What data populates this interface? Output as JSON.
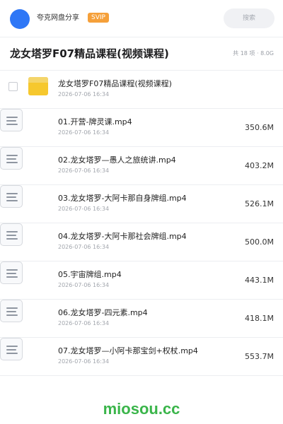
{
  "header": {
    "brand": "夸克网盘分享",
    "badge": "SVIP",
    "search_placeholder": "搜索"
  },
  "share": {
    "title": "龙女塔罗F07精品课程(视频课程)",
    "meta": "共 18 项 · 8.0G"
  },
  "files": [
    {
      "name": "龙女塔罗F07精品课程(视频课程)",
      "date": "2026-07-06 16:34",
      "size": "",
      "type": "folder"
    },
    {
      "name": "01.开营-牌灵课.mp4",
      "date": "2026-07-06 16:34",
      "size": "350.6M",
      "type": "file"
    },
    {
      "name": "02.龙女塔罗—愚人之旅统讲.mp4",
      "date": "2026-07-06 16:34",
      "size": "403.2M",
      "type": "file"
    },
    {
      "name": "03.龙女塔罗-大阿卡那自身牌组.mp4",
      "date": "2026-07-06 16:34",
      "size": "526.1M",
      "type": "file"
    },
    {
      "name": "04.龙女塔罗-大阿卡那社会牌组.mp4",
      "date": "2026-07-06 16:34",
      "size": "500.0M",
      "type": "file"
    },
    {
      "name": "05.宇宙牌组.mp4",
      "date": "2026-07-06 16:34",
      "size": "443.1M",
      "type": "file"
    },
    {
      "name": "06.龙女塔罗-四元素.mp4",
      "date": "2026-07-06 16:34",
      "size": "418.1M",
      "type": "file"
    },
    {
      "name": "07.龙女塔罗—小阿卡那宝剑+权杖.mp4",
      "date": "2026-07-06 16:34",
      "size": "553.7M",
      "type": "file"
    }
  ],
  "watermark": "miosou.cc",
  "colors": {
    "accent": "#2e77f6",
    "badge": "#f5a03a",
    "folder": "#f6c82e",
    "watermark": "#3ab54a"
  }
}
